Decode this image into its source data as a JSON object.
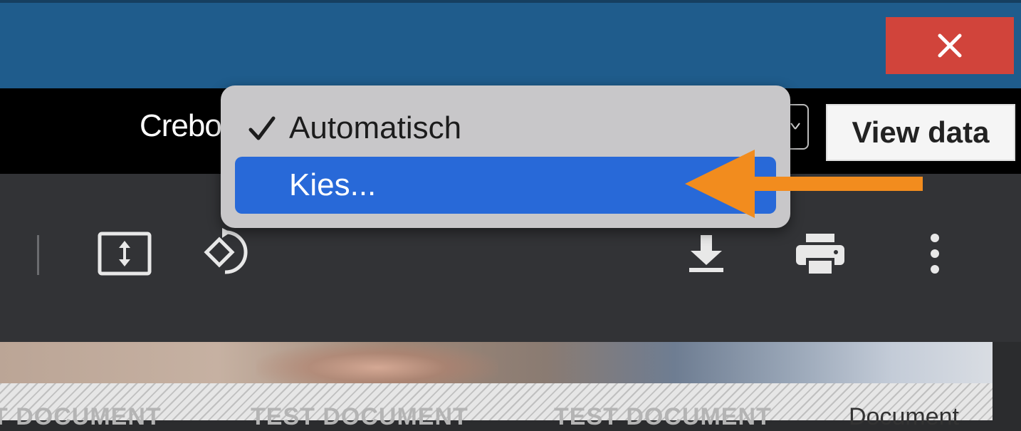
{
  "window": {
    "close_icon": "close-icon",
    "close_color": "#d1443b",
    "title_bar_color": "#1f5c8c"
  },
  "header": {
    "field_label": "Crebo",
    "view_data_label": "View data"
  },
  "dropdown": {
    "options": [
      {
        "label": "Automatisch",
        "checked": true
      },
      {
        "label": "Kies...",
        "highlighted": true
      }
    ],
    "highlight_color": "#2869d8"
  },
  "toolbar": {
    "icons": [
      "fit-page-icon",
      "rotate-icon",
      "download-icon",
      "print-icon",
      "more-vert-icon"
    ]
  },
  "document": {
    "watermarks": [
      "T DOCUMENT",
      "TEST DOCUMENT",
      "TEST DOCUMENT"
    ],
    "label": "Document"
  },
  "annotation": {
    "arrow_color": "#f28c1e"
  }
}
